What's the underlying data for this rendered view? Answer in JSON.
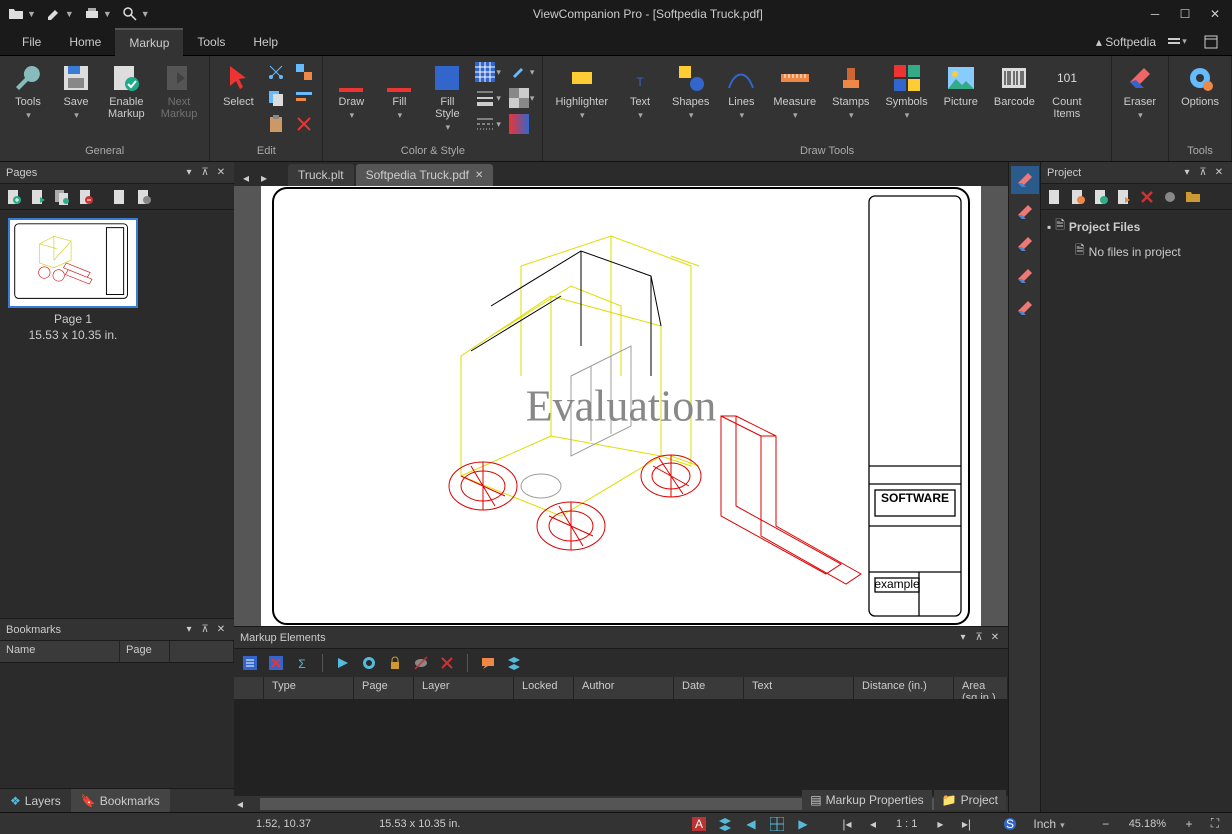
{
  "title": "ViewCompanion Pro - [Softpedia Truck.pdf]",
  "brand": "Softpedia",
  "menu": {
    "file": "File",
    "home": "Home",
    "markup": "Markup",
    "tools": "Tools",
    "help": "Help"
  },
  "ribbon": {
    "general": {
      "label": "General",
      "tools": "Tools",
      "save": "Save",
      "enable": "Enable\nMarkup",
      "next": "Next\nMarkup"
    },
    "edit": {
      "label": "Edit",
      "select": "Select"
    },
    "color": {
      "label": "Color & Style",
      "draw": "Draw",
      "fill": "Fill",
      "fillstyle": "Fill\nStyle"
    },
    "drawtools": {
      "label": "Draw Tools",
      "highlighter": "Highlighter",
      "text": "Text",
      "shapes": "Shapes",
      "lines": "Lines",
      "measure": "Measure",
      "stamps": "Stamps",
      "symbols": "Symbols",
      "picture": "Picture",
      "barcode": "Barcode",
      "count": "Count\nItems"
    },
    "eraser": "Eraser",
    "tools_group": {
      "label": "Tools",
      "options": "Options"
    }
  },
  "pages_panel": {
    "title": "Pages",
    "page_label": "Page 1",
    "page_dims": "15.53 x 10.35 in."
  },
  "bookmarks_panel": {
    "title": "Bookmarks",
    "col_name": "Name",
    "col_page": "Page"
  },
  "left_tabs": {
    "layers": "Layers",
    "bookmarks": "Bookmarks"
  },
  "doc_tabs": {
    "tab1": "Truck.plt",
    "tab2": "Softpedia Truck.pdf"
  },
  "watermark": "Evaluation",
  "title_block": {
    "software": "SOFTWARE",
    "example": "example"
  },
  "markup_elements": {
    "title": "Markup Elements",
    "cols": {
      "type": "Type",
      "page": "Page",
      "layer": "Layer",
      "locked": "Locked",
      "author": "Author",
      "date": "Date",
      "text": "Text",
      "distance": "Distance (in.)",
      "area": "Area (sq.in.)"
    }
  },
  "project_panel": {
    "title": "Project",
    "root": "Project Files",
    "empty": "No files in project"
  },
  "float_tabs": {
    "markup_props": "Markup Properties",
    "project": "Project"
  },
  "status": {
    "coords": "1.52, 10.37",
    "dims": "15.53 x 10.35 in.",
    "ratio": "1 : 1",
    "unit": "Inch",
    "zoom": "45.18%"
  }
}
